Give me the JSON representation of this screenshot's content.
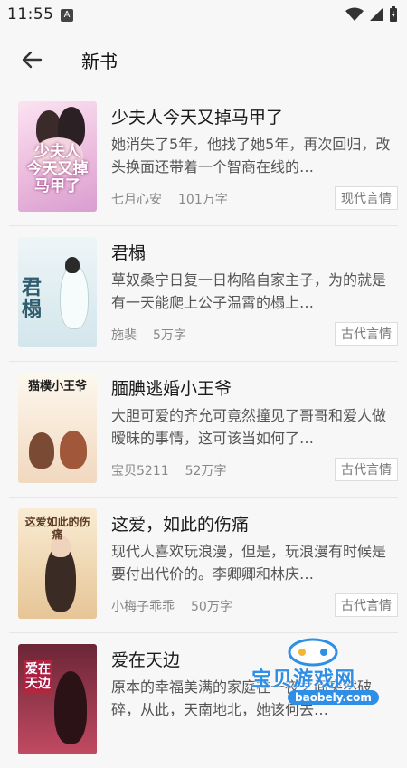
{
  "status_bar": {
    "time": "11:55",
    "notif_letter": "A"
  },
  "header": {
    "title": "新书"
  },
  "books": [
    {
      "title": "少夫人今天又掉马甲了",
      "description": "她消失了5年，他找了她5年，再次回归，改头换面还带着一个智商在线的…",
      "author": "七月心安",
      "word_count": "101万字",
      "category": "现代言情",
      "cover_text": "少夫人\n今天又掉\n马甲了",
      "cover_colors": [
        "#f8d7ec",
        "#e3b5dc"
      ]
    },
    {
      "title": "君榻",
      "description": "草奴桑宁日复一日构陷自家主子，为的就是有一天能爬上公子温霄的榻上…",
      "author": "施裴",
      "word_count": "5万字",
      "category": "古代言情",
      "cover_text": "君\n榻",
      "cover_colors": [
        "#e8f1f4",
        "#cfe3ea"
      ]
    },
    {
      "title": "腼腆逃婚小王爷",
      "description": "大胆可爱的齐允可竟然撞见了哥哥和爱人做暧昧的事情，这可该当如何了…",
      "author": "宝贝5211",
      "word_count": "52万字",
      "category": "古代言情",
      "cover_text": "猫樸小王爷",
      "cover_colors": [
        "#fbf4e6",
        "#f3dcc3"
      ]
    },
    {
      "title": "这爱，如此的伤痛",
      "description": "现代人喜欢玩浪漫，但是，玩浪漫有时候是要付出代价的。李卿卿和林庆…",
      "author": "小梅子乖乖",
      "word_count": "50万字",
      "category": "古代言情",
      "cover_text": "这爱如此的伤痛",
      "cover_colors": [
        "#f6e5c6",
        "#e6c796"
      ]
    },
    {
      "title": "爱在天边",
      "description": "原本的幸福美满的家庭在一夜之间突然破碎，从此，天南地北，她该何去…",
      "author": "",
      "word_count": "",
      "category": "",
      "cover_text": "爱在\n天边",
      "cover_colors": [
        "#6b2636",
        "#c14a62"
      ]
    }
  ],
  "watermark": {
    "text": "宝贝游戏网",
    "url": "baobely.com"
  }
}
